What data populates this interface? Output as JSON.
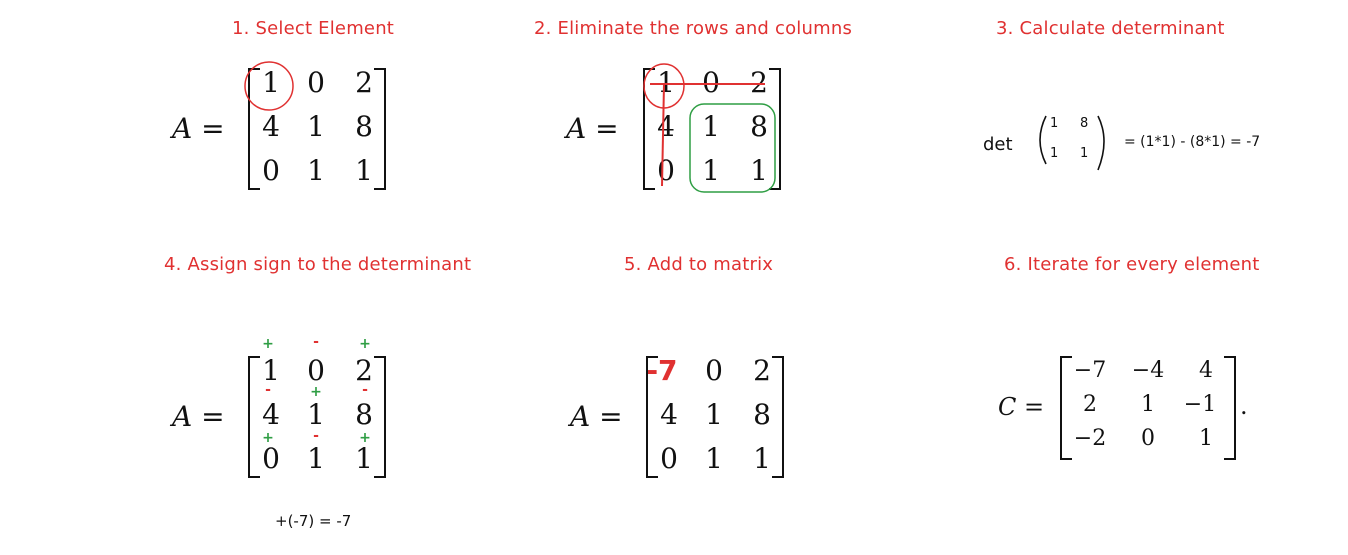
{
  "steps": [
    {
      "title": "1. Select Element"
    },
    {
      "title": "2. Eliminate the rows and columns"
    },
    {
      "title": "3. Calculate determinant"
    },
    {
      "title": "4. Assign sign to the determinant"
    },
    {
      "title": "5. Add to matrix"
    },
    {
      "title": "6. Iterate for every element"
    }
  ],
  "matrix_label": "A =",
  "matrix_A": [
    [
      "1",
      "0",
      "2"
    ],
    [
      "4",
      "1",
      "8"
    ],
    [
      "0",
      "1",
      "1"
    ]
  ],
  "matrix_step5": [
    [
      "-7",
      "0",
      "2"
    ],
    [
      "4",
      "1",
      "8"
    ],
    [
      "0",
      "1",
      "1"
    ]
  ],
  "det_expr": {
    "prefix": "det",
    "minor": [
      [
        "1",
        "8"
      ],
      [
        "1",
        "1"
      ]
    ],
    "result": "= (1*1) - (8*1) = -7"
  },
  "signs": [
    [
      "+",
      "-",
      "+"
    ],
    [
      "-",
      "+",
      "-"
    ],
    [
      "+",
      "-",
      "+"
    ]
  ],
  "sign_result": "+(-7) = -7",
  "cofactor_label": "C =",
  "matrix_C": [
    [
      "−7",
      "−4",
      "4"
    ],
    [
      "2",
      "1",
      "−1"
    ],
    [
      "−2",
      "0",
      "1"
    ]
  ],
  "cofactor_suffix": ".",
  "colors": {
    "step_title": "#e03131",
    "highlight": "#e03131",
    "minor_box": "#2f9e44",
    "plus": "#2f9e44",
    "minus": "#e03131"
  }
}
